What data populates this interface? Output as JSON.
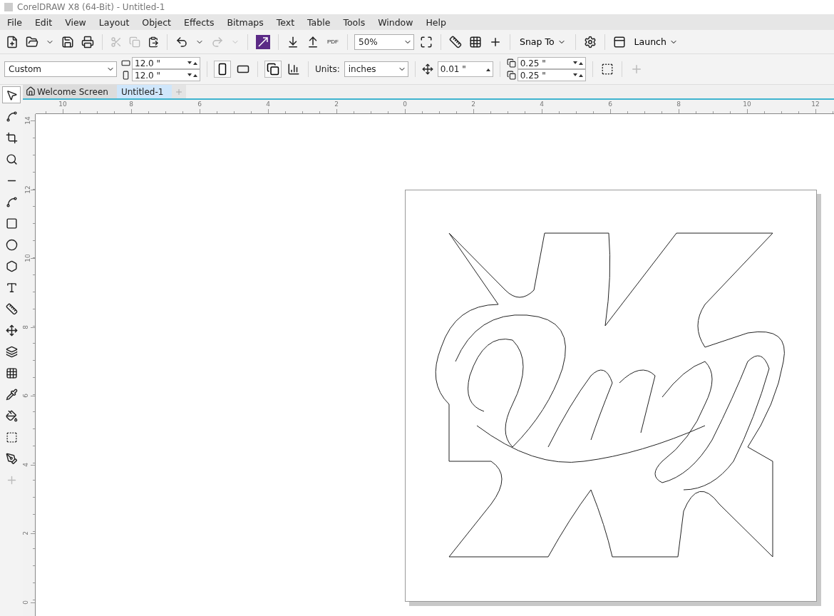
{
  "window": {
    "title": "CorelDRAW X8 (64-Bit) - Untitled-1"
  },
  "menu": [
    "File",
    "Edit",
    "View",
    "Layout",
    "Object",
    "Effects",
    "Bitmaps",
    "Text",
    "Table",
    "Tools",
    "Window",
    "Help"
  ],
  "standard_toolbar": {
    "pdf_label": "PDF",
    "zoom": "50%",
    "snap": "Snap To",
    "launch": "Launch"
  },
  "property_bar": {
    "page_size": "Custom",
    "width": "12.0 \"",
    "height": "12.0 \"",
    "units_label": "Units:",
    "units": "inches",
    "nudge": "0.01 \"",
    "duplicate_x": "0.25 \"",
    "duplicate_y": "0.25 \""
  },
  "tabs": [
    {
      "label": "Welcome Screen",
      "selected": false
    },
    {
      "label": "Untitled-1",
      "selected": true
    }
  ],
  "tools": [
    {
      "kind": "pick",
      "selected": true
    },
    {
      "kind": "shape",
      "selected": false
    },
    {
      "kind": "crop",
      "selected": false
    },
    {
      "kind": "zoom",
      "selected": false
    },
    {
      "kind": "line",
      "selected": false
    },
    {
      "kind": "curve",
      "selected": false
    },
    {
      "kind": "rect",
      "selected": false
    },
    {
      "kind": "ellipse",
      "selected": false
    },
    {
      "kind": "polygon",
      "selected": false
    },
    {
      "kind": "text",
      "selected": false
    },
    {
      "kind": "dimension",
      "selected": false
    },
    {
      "kind": "connector",
      "selected": false
    },
    {
      "kind": "shadow",
      "selected": false
    },
    {
      "kind": "transparency",
      "selected": false
    },
    {
      "kind": "eyedropper",
      "selected": false
    },
    {
      "kind": "fill",
      "selected": false
    },
    {
      "kind": "outline",
      "selected": false
    },
    {
      "kind": "pen",
      "selected": false
    },
    {
      "kind": "add",
      "selected": false
    }
  ],
  "horizontal_ruler": [
    "10",
    "8",
    "6",
    "4",
    "2",
    "0",
    "2",
    "4",
    "6",
    "8",
    "10",
    "12"
  ],
  "vertical_ruler": [
    "14",
    "12",
    "10",
    "8",
    "6",
    "4",
    "2",
    "0"
  ]
}
